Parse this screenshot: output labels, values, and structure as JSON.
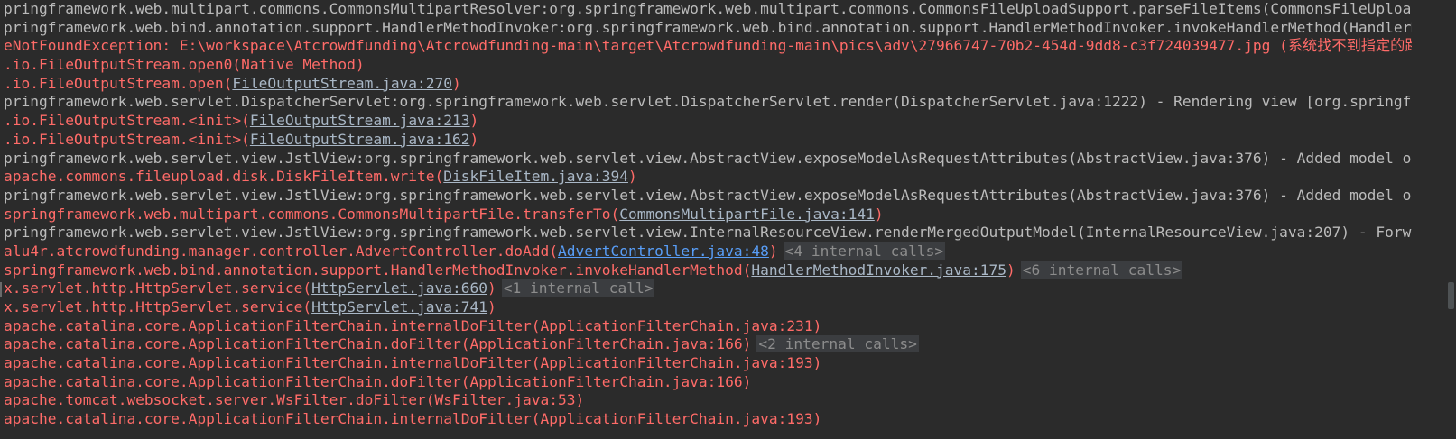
{
  "console": {
    "lines": [
      {
        "type": "log",
        "text": "pringframework.web.multipart.commons.CommonsMultipartResolver:org.springframework.web.multipart.commons.CommonsFileUploadSupport.parseFileItems(CommonsFileUpload"
      },
      {
        "type": "log",
        "text": "pringframework.web.bind.annotation.support.HandlerMethodInvoker:org.springframework.web.bind.annotation.support.HandlerMethodInvoker.invokeHandlerMethod(HandlerMe"
      },
      {
        "type": "error",
        "text": "eNotFoundException: E:\\workspace\\Atcrowdfunding\\Atcrowdfunding-main\\target\\Atcrowdfunding-main\\pics\\adv\\27966747-70b2-454d-9dd8-c3f724039477.jpg (系统找不到指定的路径"
      },
      {
        "type": "frame",
        "prefix": ".io.FileOutputStream.open0(Native Method)"
      },
      {
        "type": "frame",
        "prefix": ".io.FileOutputStream.open(",
        "link": "FileOutputStream.java:270",
        "suffix": ")"
      },
      {
        "type": "log",
        "text": "pringframework.web.servlet.DispatcherServlet:org.springframework.web.servlet.DispatcherServlet.render(DispatcherServlet.java:1222) - Rendering view [org.springfra"
      },
      {
        "type": "frame",
        "prefix": ".io.FileOutputStream.<init>(",
        "link": "FileOutputStream.java:213",
        "suffix": ")"
      },
      {
        "type": "frame",
        "prefix": ".io.FileOutputStream.<init>(",
        "link": "FileOutputStream.java:162",
        "suffix": ")"
      },
      {
        "type": "log",
        "text": "pringframework.web.servlet.view.JstlView:org.springframework.web.servlet.view.AbstractView.exposeModelAsRequestAttributes(AbstractView.java:376) - Added model ob"
      },
      {
        "type": "frame",
        "prefix": "apache.commons.fileupload.disk.DiskFileItem.write(",
        "link": "DiskFileItem.java:394",
        "suffix": ")"
      },
      {
        "type": "log",
        "text": "pringframework.web.servlet.view.JstlView:org.springframework.web.servlet.view.AbstractView.exposeModelAsRequestAttributes(AbstractView.java:376) - Added model ob"
      },
      {
        "type": "frame",
        "prefix": "springframework.web.multipart.commons.CommonsMultipartFile.transferTo(",
        "link": "CommonsMultipartFile.java:141",
        "suffix": ")"
      },
      {
        "type": "log",
        "text": "pringframework.web.servlet.view.JstlView:org.springframework.web.servlet.view.InternalResourceView.renderMergedOutputModel(InternalResourceView.java:207) - Forwa"
      },
      {
        "type": "frame",
        "prefix": "alu4r.atcrowdfunding.manager.controller.AdvertController.doAdd(",
        "link": "AdvertController.java:48",
        "linkColor": "blue",
        "suffix": ")",
        "internal": "<4 internal calls>"
      },
      {
        "type": "frame",
        "prefix": "springframework.web.bind.annotation.support.HandlerMethodInvoker.invokeHandlerMethod(",
        "link": "HandlerMethodInvoker.java:175",
        "suffix": ")",
        "internal": "<6 internal calls>"
      },
      {
        "type": "frame",
        "prefix": "x.servlet.http.HttpServlet.service(",
        "link": "HttpServlet.java:660",
        "suffix": ")",
        "internal": "<1 internal call>"
      },
      {
        "type": "frame",
        "prefix": "x.servlet.http.HttpServlet.service(",
        "link": "HttpServlet.java:741",
        "suffix": ")"
      },
      {
        "type": "frame",
        "prefix": "apache.catalina.core.ApplicationFilterChain.internalDoFilter(ApplicationFilterChain.java:231)"
      },
      {
        "type": "frame",
        "prefix": "apache.catalina.core.ApplicationFilterChain.doFilter(ApplicationFilterChain.java:166)",
        "internal": "<2 internal calls>"
      },
      {
        "type": "frame",
        "prefix": "apache.catalina.core.ApplicationFilterChain.internalDoFilter(ApplicationFilterChain.java:193)"
      },
      {
        "type": "frame",
        "prefix": "apache.catalina.core.ApplicationFilterChain.doFilter(ApplicationFilterChain.java:166)"
      },
      {
        "type": "frame",
        "prefix": "apache.tomcat.websocket.server.WsFilter.doFilter(WsFilter.java:53)"
      },
      {
        "type": "frame",
        "prefix": "apache.catalina.core.ApplicationFilterChain.internalDoFilter(ApplicationFilterChain.java:193)"
      }
    ]
  },
  "colors": {
    "background": "#2b2b2b",
    "log_text": "#bbbbbb",
    "error_text": "#ff6b68",
    "link_text": "#a9b7c6",
    "link_highlight": "#589df6",
    "internal_calls_text": "#8c8c8c",
    "internal_calls_bg": "#3b3d40"
  }
}
